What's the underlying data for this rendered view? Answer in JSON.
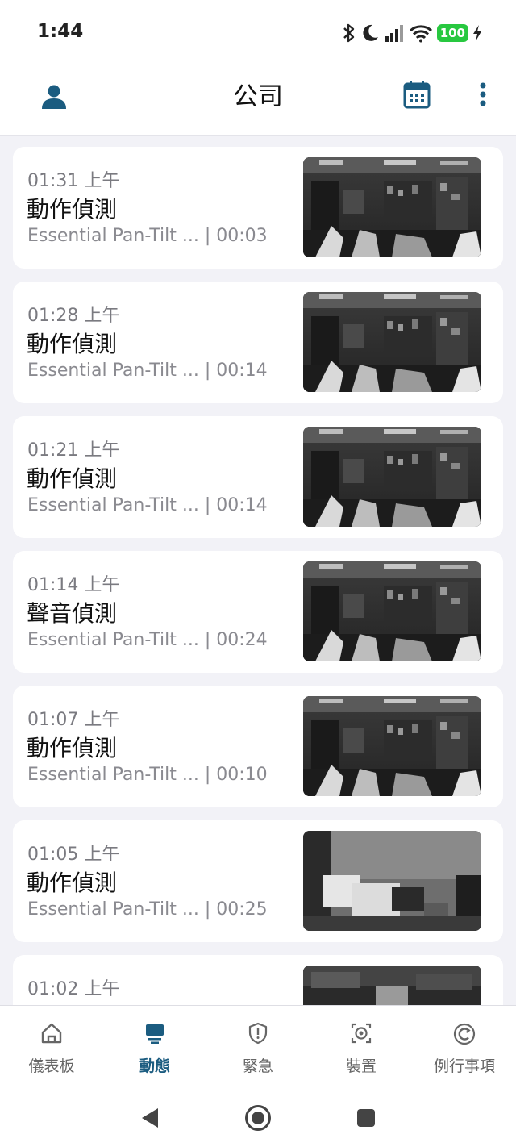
{
  "status": {
    "time": "1:44",
    "battery": "100"
  },
  "appbar": {
    "title": "公司"
  },
  "events": [
    {
      "time": "01:31 上午",
      "title": "動作偵測",
      "subtitle": "Essential Pan-Tilt ... | 00:03"
    },
    {
      "time": "01:28 上午",
      "title": "動作偵測",
      "subtitle": "Essential Pan-Tilt ... | 00:14"
    },
    {
      "time": "01:21 上午",
      "title": "動作偵測",
      "subtitle": "Essential Pan-Tilt ... | 00:14"
    },
    {
      "time": "01:14 上午",
      "title": "聲音偵測",
      "subtitle": "Essential Pan-Tilt ... | 00:24"
    },
    {
      "time": "01:07 上午",
      "title": "動作偵測",
      "subtitle": "Essential Pan-Tilt ... | 00:10"
    },
    {
      "time": "01:05 上午",
      "title": "動作偵測",
      "subtitle": "Essential Pan-Tilt ... | 00:25"
    },
    {
      "time": "01:02 上午",
      "title": "",
      "subtitle": ""
    }
  ],
  "nav": [
    {
      "label": "儀表板",
      "icon": "home-icon"
    },
    {
      "label": "動態",
      "icon": "activity-icon",
      "active": true
    },
    {
      "label": "緊急",
      "icon": "shield-alert-icon"
    },
    {
      "label": "裝置",
      "icon": "camera-device-icon"
    },
    {
      "label": "例行事項",
      "icon": "routine-icon"
    }
  ],
  "colors": {
    "accent": "#1b5c80",
    "background": "#f2f2f7",
    "battery": "#28c840"
  }
}
